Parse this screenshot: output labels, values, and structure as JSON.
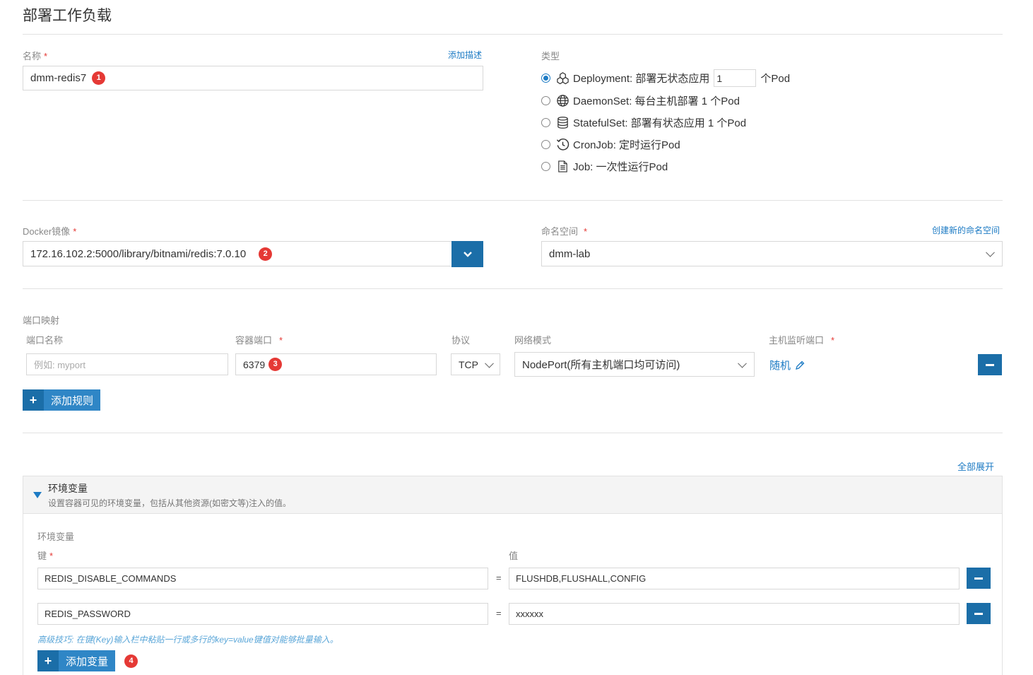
{
  "page": {
    "title": "部署工作负载"
  },
  "name": {
    "label": "名称",
    "required": "*",
    "add_desc": "添加描述",
    "value": "dmm-redis7",
    "badge": "1"
  },
  "type": {
    "label": "类型",
    "options": [
      {
        "id": "deployment",
        "text": "Deployment: 部署无状态应用",
        "icon": "deployment-icon",
        "selected": true
      },
      {
        "id": "daemonset",
        "text": "DaemonSet: 每台主机部署 1 个Pod",
        "icon": "globe-icon",
        "selected": false
      },
      {
        "id": "statefulset",
        "text": "StatefulSet: 部署有状态应用 1 个Pod",
        "icon": "database-icon",
        "selected": false
      },
      {
        "id": "cronjob",
        "text": "CronJob: 定时运行Pod",
        "icon": "clock-icon",
        "selected": false
      },
      {
        "id": "job",
        "text": "Job: 一次性运行Pod",
        "icon": "document-icon",
        "selected": false
      }
    ],
    "replicas": "1",
    "replicas_suffix": "个Pod"
  },
  "docker": {
    "label": "Docker镜像",
    "required": "*",
    "value": "172.16.102.2:5000/library/bitnami/redis:7.0.10",
    "badge": "2"
  },
  "namespace": {
    "label": "命名空间",
    "required": "*",
    "create_link": "创建新的命名空间",
    "value": "dmm-lab"
  },
  "ports": {
    "section_label": "端口映射",
    "col_name": "端口名称",
    "col_container": "容器端口",
    "col_protocol": "协议",
    "col_network": "网络模式",
    "col_host": "主机监听端口",
    "required": "*",
    "name_placeholder": "例如: myport",
    "container_port": "6379",
    "badge": "3",
    "protocol": "TCP",
    "network_mode": "NodePort(所有主机端口均可访问)",
    "host_port": "随机",
    "add_rule": "添加规则"
  },
  "env": {
    "expand_all": "全部展开",
    "section_title": "环境变量",
    "section_desc": "设置容器可见的环境变量，包括从其他资源(如密文等)注入的值。",
    "inner_label": "环境变量",
    "key_label": "键",
    "required": "*",
    "value_label": "值",
    "eq": "=",
    "rows": [
      {
        "key": "REDIS_DISABLE_COMMANDS",
        "value": "FLUSHDB,FLUSHALL,CONFIG"
      },
      {
        "key": "REDIS_PASSWORD",
        "value": "xxxxxx"
      }
    ],
    "tip": "高级技巧: 在键(Key)输入栏中粘贴一行或多行的key=value键值对能够批量输入。",
    "add_var": "添加变量",
    "badge": "4"
  },
  "colors": {
    "accent": "#1b6ea8",
    "badge": "#e53935",
    "link": "#1d7bc4"
  }
}
